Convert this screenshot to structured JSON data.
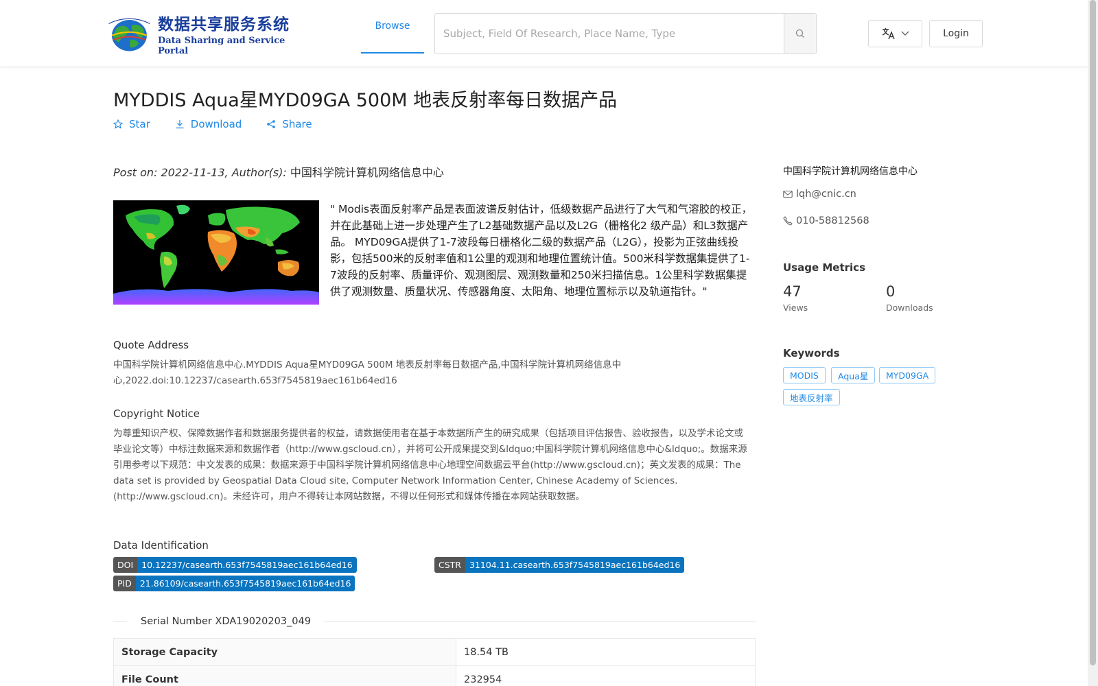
{
  "header": {
    "logo_cn": "数据共享服务系统",
    "logo_en": "Data Sharing and Service Portal",
    "nav_browse": "Browse",
    "search_placeholder": "Subject, Field Of Research, Place Name, Type",
    "login_label": "Login"
  },
  "dataset": {
    "title": "MYDDIS Aqua星MYD09GA 500M 地表反射率每日数据产品",
    "actions": {
      "star": "Star",
      "download": "Download",
      "share": "Share"
    },
    "post_prefix": "Post on: 2022-11-13, Author(s): ",
    "authors": "中国科学院计算机网络信息中心",
    "description": "\" Modis表面反射率产品是表面波谱反射估计，低级数据产品进行了大气和气溶胶的校正，并在此基础上进一步处理产生了L2基础数据产品以及L2G（栅格化2 级产品）和L3数据产品。 MYD09GA提供了1-7波段每日栅格化二级的数据产品（L2G），投影为正弦曲线投影，包括500米的反射率值和1公里的观测和地理位置统计值。500米科学数据集提供了1-7波段的反射率、质量评价、观测图层、观测数量和250米扫描信息。1公里科学数据集提供了观测数量、质量状况、传感器角度、太阳角、地理位置标示以及轨道指针。\""
  },
  "quote": {
    "title": "Quote Address",
    "text": "中国科学院计算机网络信息中心.MYDDIS Aqua星MYD09GA 500M 地表反射率每日数据产品,中国科学院计算机网络信息中心,2022.doi:10.12237/casearth.653f7545819aec161b64ed16"
  },
  "copyright": {
    "title": "Copyright Notice",
    "text": "为尊重知识产权、保障数据作者和数据服务提供者的权益，请数据使用者在基于本数据所产生的研究成果（包括项目评估报告、验收报告，以及学术论文或毕业论文等）中标注数据来源和数据作者（http://www.gscloud.cn），并将可公开成果提交到&ldquo;中国科学院计算机网络信息中心&ldquo;。数据来源引用参考以下规范：中文发表的成果：数据来源于中国科学院计算机网络信息中心地理空间数据云平台(http://www.gscloud.cn)；英文发表的成果：The data set is provided by Geospatial Data Cloud site, Computer Network Information Center, Chinese Academy of Sciences. (http://www.gscloud.cn)。未经许可，用户不得转让本网站数据，不得以任何形式和媒体传播在本网站获取数据。"
  },
  "identification": {
    "title": "Data Identification",
    "doi_key": "DOI",
    "doi_value": "10.12237/casearth.653f7545819aec161b64ed16",
    "cstr_key": "CSTR",
    "cstr_value": "31104.11.casearth.653f7545819aec161b64ed16",
    "pid_key": "PID",
    "pid_value": "21.86109/casearth.653f7545819aec161b64ed16"
  },
  "serial": "Serial Number XDA19020203_049",
  "meta_rows": [
    {
      "label": "Storage Capacity",
      "value": "18.54 TB"
    },
    {
      "label": "File Count",
      "value": "232954"
    }
  ],
  "sidebar": {
    "org": "中国科学院计算机网络信息中心",
    "email": "lqh@cnic.cn",
    "phone": "010-58812568",
    "usage_title": "Usage Metrics",
    "views_value": "47",
    "views_label": "Views",
    "downloads_value": "0",
    "downloads_label": "Downloads",
    "keywords_title": "Keywords",
    "keywords": [
      "MODIS",
      "Aqua星",
      "MYD09GA",
      "地表反射率"
    ]
  },
  "colors": {
    "accent": "#1e88e5",
    "badge_key": "#555555",
    "badge_value": "#0a74bf"
  }
}
